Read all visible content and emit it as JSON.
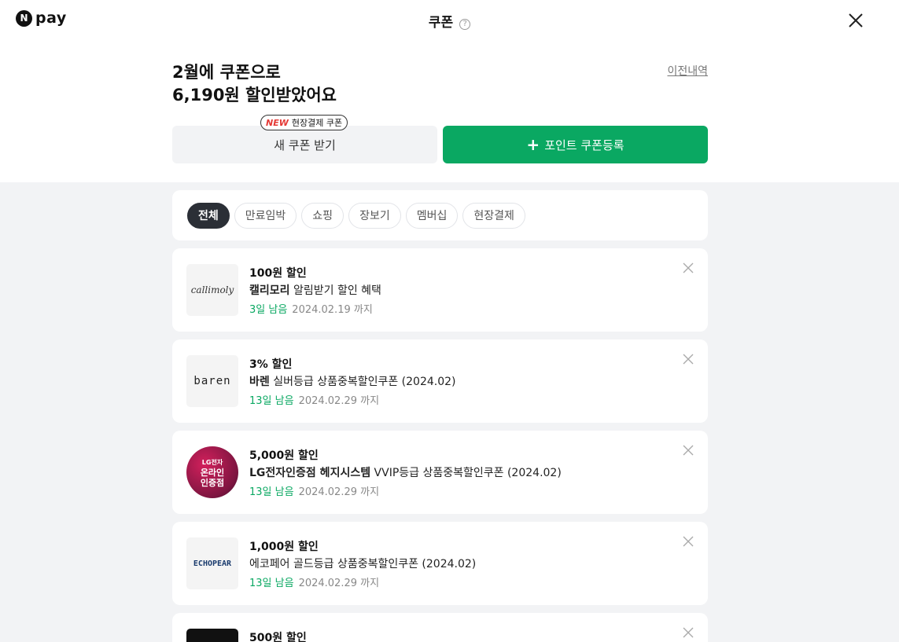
{
  "header": {
    "logo_mark": "N",
    "logo_text": "pay",
    "title": "쿠폰",
    "help_glyph": "?"
  },
  "summary": {
    "line1": "2월에 쿠폰으로",
    "line2": "6,190원 할인받았어요",
    "history_link": "이전내역"
  },
  "actions": {
    "badge_new": "NEW",
    "badge_text": "현장결제 쿠폰",
    "new_coupon": "새 쿠폰 받기",
    "register_plus": "+",
    "register": "포인트 쿠폰등록"
  },
  "filters": [
    "전체",
    "만료임박",
    "쇼핑",
    "장보기",
    "멤버십",
    "현장결제"
  ],
  "coupons": [
    {
      "amount": "100원 할인",
      "brand": "캘리모리",
      "desc": "알림받기 할인 혜택",
      "left": "3일 남음",
      "due": "2024.02.19 까지",
      "logo": "callimoly"
    },
    {
      "amount": "3% 할인",
      "brand": "바렌",
      "desc": "실버등급 상품중복할인쿠폰 (2024.02)",
      "left": "13일 남음",
      "due": "2024.02.29 까지",
      "logo": "baren"
    },
    {
      "amount": "5,000원 할인",
      "brand": "LG전자인증점 헤지시스템",
      "desc": "VVIP등급 상품중복할인쿠폰 (2024.02)",
      "left": "13일 남음",
      "due": "2024.02.29 까지",
      "logo_line1": "LG전자",
      "logo_line2": "온라인",
      "logo_line3": "인증점"
    },
    {
      "amount": "1,000원 할인",
      "brand": "",
      "desc": "에코페어 골드등급 상품중복할인쿠폰 (2024.02)",
      "left": "13일 남음",
      "due": "2024.02.29 까지",
      "logo": "ECHOPEAR"
    },
    {
      "amount": "500원 할인"
    }
  ],
  "colors": {
    "accent_green": "#0aa862",
    "chip_active": "#2b2f36",
    "background": "#f2f3f5"
  }
}
